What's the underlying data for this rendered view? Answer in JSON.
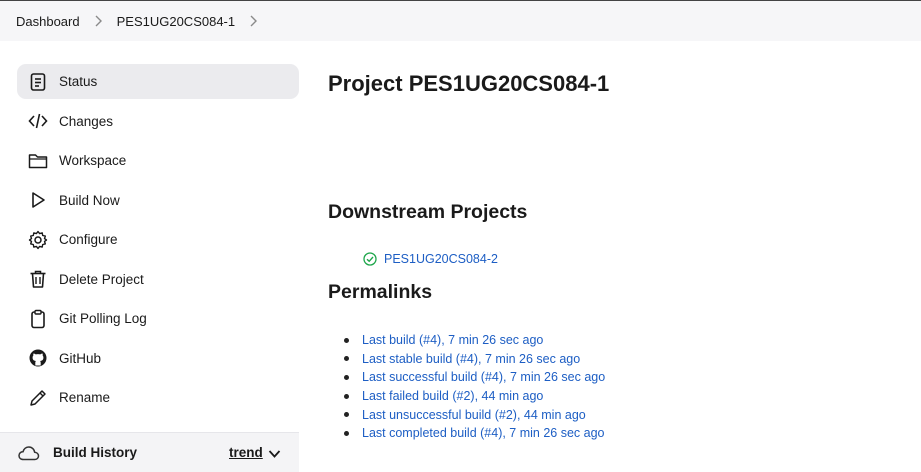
{
  "breadcrumb": {
    "items": [
      {
        "label": "Dashboard"
      },
      {
        "label": "PES1UG20CS084-1"
      }
    ]
  },
  "sidebar": {
    "items": [
      {
        "label": "Status",
        "icon": "status-icon",
        "active": true
      },
      {
        "label": "Changes",
        "icon": "code-icon"
      },
      {
        "label": "Workspace",
        "icon": "folder-icon"
      },
      {
        "label": "Build Now",
        "icon": "play-icon"
      },
      {
        "label": "Configure",
        "icon": "gear-icon"
      },
      {
        "label": "Delete Project",
        "icon": "trash-icon"
      },
      {
        "label": "Git Polling Log",
        "icon": "clipboard-icon"
      },
      {
        "label": "GitHub",
        "icon": "github-icon"
      },
      {
        "label": "Rename",
        "icon": "pencil-icon"
      }
    ]
  },
  "build_history": {
    "title": "Build History",
    "trend_label": "trend",
    "icon": "cloud-icon"
  },
  "main": {
    "title": "Project PES1UG20CS084-1",
    "downstream": {
      "heading": "Downstream Projects",
      "projects": [
        {
          "name": "PES1UG20CS084-2",
          "status": "success",
          "status_color": "#1ea64b"
        }
      ]
    },
    "permalinks": {
      "heading": "Permalinks",
      "links": [
        "Last build (#4), 7 min 26 sec ago",
        "Last stable build (#4), 7 min 26 sec ago",
        "Last successful build (#4), 7 min 26 sec ago",
        "Last failed build (#2), 44 min ago",
        "Last unsuccessful build (#2), 44 min ago",
        "Last completed build (#4), 7 min 26 sec ago"
      ]
    }
  },
  "colors": {
    "link": "#1d5ec4",
    "active_item_bg": "#ebebee",
    "breadcrumb_bg": "#f6f6f8"
  }
}
